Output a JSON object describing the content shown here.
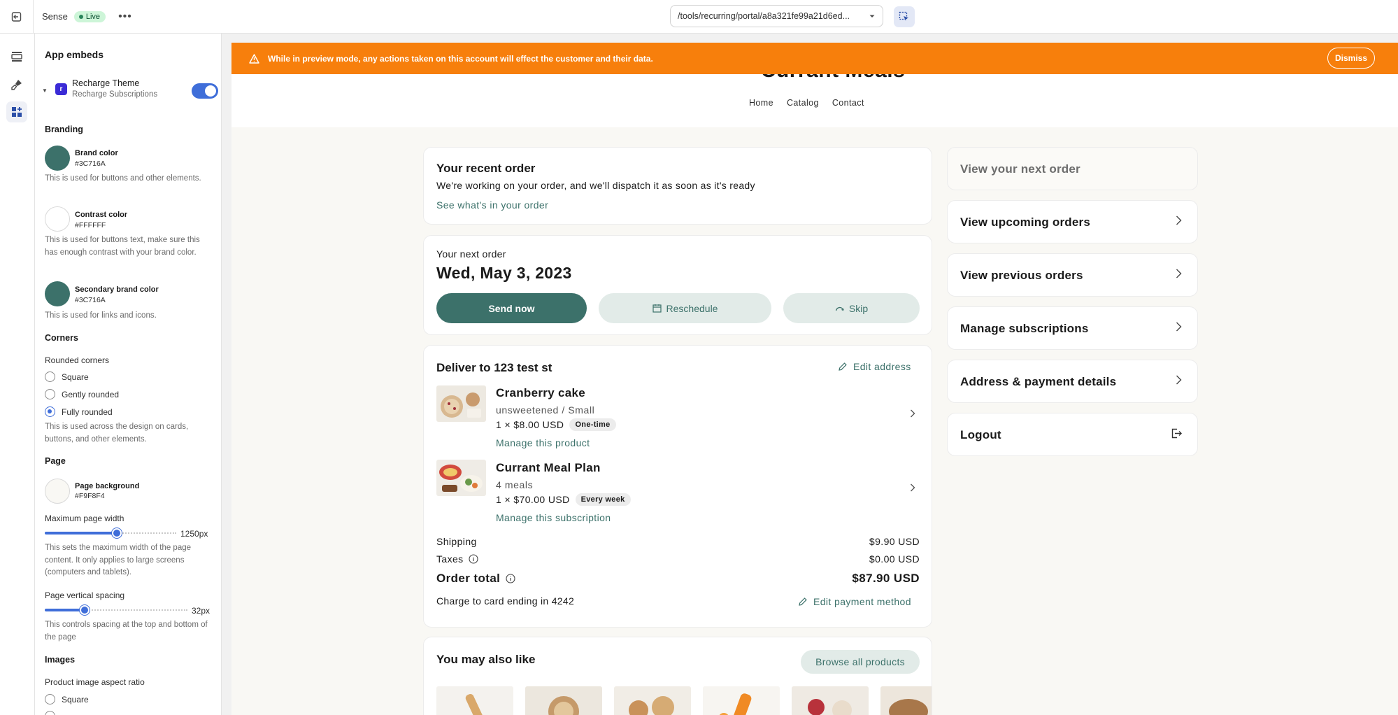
{
  "topbar": {
    "theme_name": "Sense",
    "status": "Live",
    "url": "/tools/recurring/portal/a8a321fe99a21d6ed..."
  },
  "panel": {
    "title": "App embeds",
    "embed": {
      "name": "Recharge Theme",
      "subtitle": "Recharge Subscriptions",
      "enabled": true
    },
    "branding": {
      "heading": "Branding",
      "brand": {
        "label": "Brand color",
        "hex": "#3C716A",
        "help": "This is used for buttons and other elements."
      },
      "contrast": {
        "label": "Contrast color",
        "hex": "#FFFFFF",
        "help": "This is used for buttons text, make sure this has enough contrast with your brand color."
      },
      "secondary": {
        "label": "Secondary brand color",
        "hex": "#3C716A",
        "help": "This is used for links and icons."
      }
    },
    "corners": {
      "heading": "Corners",
      "label": "Rounded corners",
      "options": [
        "Square",
        "Gently rounded",
        "Fully rounded"
      ],
      "selected": "Fully rounded",
      "help": "This is used across the design on cards, buttons, and other elements."
    },
    "page": {
      "heading": "Page",
      "background": {
        "label": "Page background",
        "hex": "#F9F8F4"
      },
      "max_width": {
        "label": "Maximum page width",
        "value": "1250px",
        "fraction": 0.55,
        "help": "This sets the maximum width of the page content. It only applies to large screens (computers and tablets)."
      },
      "spacing": {
        "label": "Page vertical spacing",
        "value": "32px",
        "fraction": 0.28,
        "help": "This controls spacing at the top and bottom of the page"
      }
    },
    "images": {
      "heading": "Images",
      "label": "Product image aspect ratio",
      "option1": "Square"
    }
  },
  "preview": {
    "banner": {
      "text": "While in preview mode, any actions taken on this account will effect the customer and their data.",
      "dismiss": "Dismiss"
    },
    "store": {
      "logo": "Currant Meals",
      "nav": [
        "Home",
        "Catalog",
        "Contact"
      ]
    },
    "recent_order": {
      "title": "Your recent order",
      "text": "We're working on your order, and we'll dispatch it as soon as it's ready",
      "link": "See what's in your order"
    },
    "next_order": {
      "label": "Your next order",
      "date": "Wed, May 3, 2023",
      "send_now": "Send now",
      "reschedule": "Reschedule",
      "skip": "Skip"
    },
    "delivery": {
      "title": "Deliver to 123 test st",
      "edit_address": "Edit address",
      "items": [
        {
          "name": "Cranberry cake",
          "variant": "unsweetened / Small",
          "price": "1 × $8.00 USD",
          "badge": "One-time",
          "link": "Manage this product"
        },
        {
          "name": "Currant Meal Plan",
          "variant": "4 meals",
          "price": "1 × $70.00 USD",
          "badge": "Every week",
          "link": "Manage this subscription"
        }
      ],
      "shipping_label": "Shipping",
      "shipping_value": "$9.90 USD",
      "taxes_label": "Taxes",
      "taxes_value": "$0.00 USD",
      "total_label": "Order total",
      "total_value": "$87.90 USD",
      "card_text": "Charge to card ending in 4242",
      "edit_payment": "Edit payment method"
    },
    "also_like": {
      "title": "You may also like",
      "browse": "Browse all products"
    },
    "side_nav": {
      "next_order": "View your next order",
      "upcoming": "View upcoming orders",
      "previous": "View previous orders",
      "subscriptions": "Manage subscriptions",
      "address_payment": "Address & payment details",
      "logout": "Logout"
    }
  },
  "colors": {
    "brand": "#3C716A",
    "banner": "#F77F0C",
    "page_bg": "#F9F8F4",
    "accent": "#3F6ED9"
  }
}
